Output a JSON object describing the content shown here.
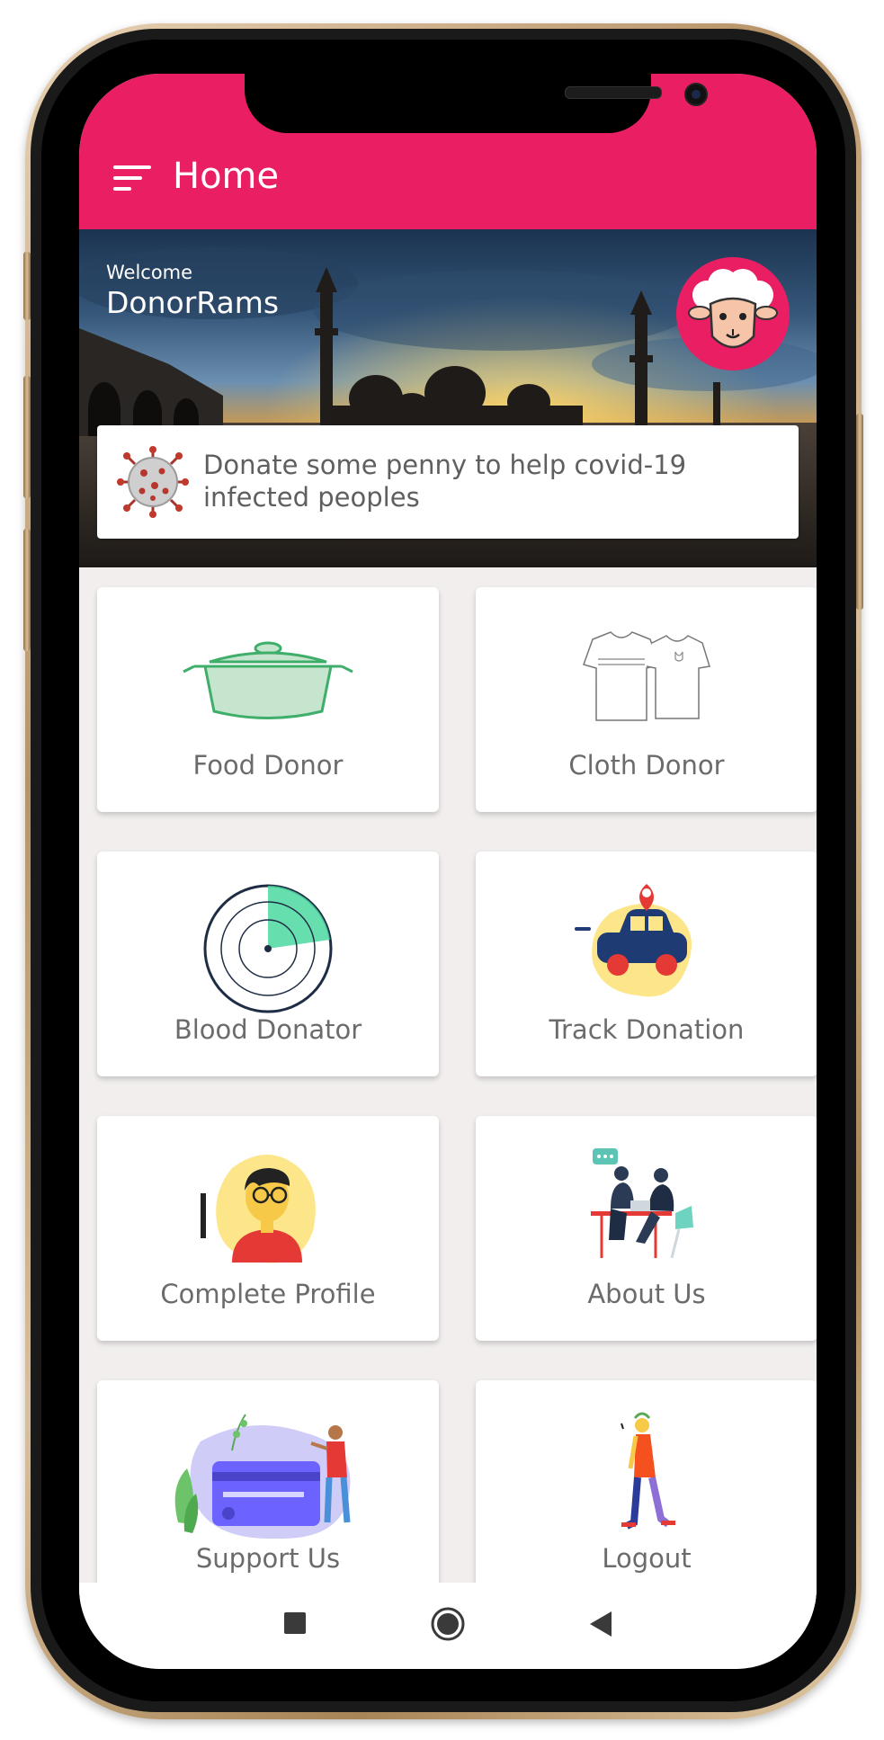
{
  "appbar": {
    "title": "Home",
    "color": "#e91e63"
  },
  "hero": {
    "welcome_label": "Welcome",
    "user_name": "DonorRams"
  },
  "banner": {
    "text": "Donate some penny to help covid-19 infected peoples"
  },
  "tiles": [
    {
      "label": "Food Donor",
      "icon": "pot-icon"
    },
    {
      "label": "Cloth Donor",
      "icon": "tshirt-icon"
    },
    {
      "label": "Blood Donator",
      "icon": "radar-icon"
    },
    {
      "label": "Track Donation",
      "icon": "car-location-icon"
    },
    {
      "label": "Complete Profile",
      "icon": "user-profile-icon"
    },
    {
      "label": "About Us",
      "icon": "meeting-icon"
    },
    {
      "label": "Support Us",
      "icon": "card-support-icon"
    },
    {
      "label": "Logout",
      "icon": "walking-person-icon"
    }
  ],
  "navbar": {
    "icons": [
      "square-icon",
      "circle-home-icon",
      "back-triangle-icon"
    ]
  }
}
